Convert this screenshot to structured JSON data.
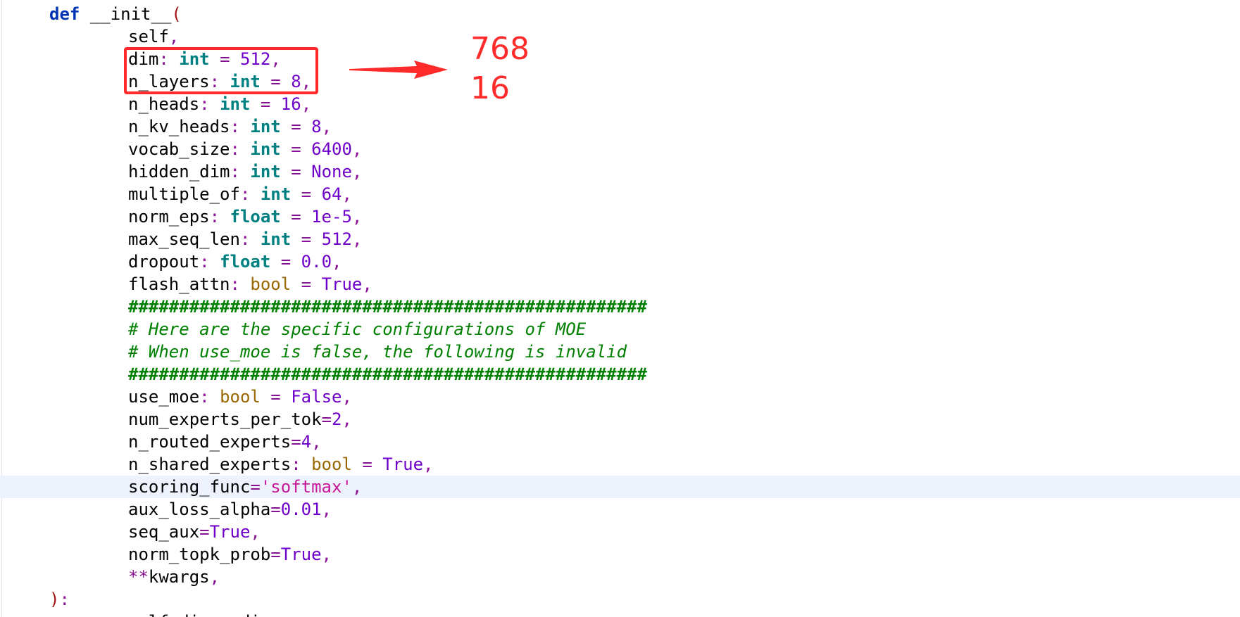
{
  "editor": {
    "lines": [
      {
        "indent": 0,
        "tokens": [
          {
            "t": "def",
            "c": "kw"
          },
          {
            "t": " __init__",
            "c": "fn"
          },
          {
            "t": "(",
            "c": "paren"
          }
        ]
      },
      {
        "indent": 1,
        "tokens": [
          {
            "t": "self",
            "c": "param"
          },
          {
            "t": ",",
            "c": "punct"
          }
        ]
      },
      {
        "indent": 1,
        "tokens": [
          {
            "t": "dim",
            "c": "param"
          },
          {
            "t": ": ",
            "c": "punct"
          },
          {
            "t": "int",
            "c": "type"
          },
          {
            "t": " = ",
            "c": "op"
          },
          {
            "t": "512",
            "c": "num"
          },
          {
            "t": ",",
            "c": "punct"
          }
        ]
      },
      {
        "indent": 1,
        "tokens": [
          {
            "t": "n_layers",
            "c": "param"
          },
          {
            "t": ": ",
            "c": "punct"
          },
          {
            "t": "int",
            "c": "type"
          },
          {
            "t": " = ",
            "c": "op"
          },
          {
            "t": "8",
            "c": "num"
          },
          {
            "t": ",",
            "c": "punct"
          }
        ]
      },
      {
        "indent": 1,
        "tokens": [
          {
            "t": "n_heads",
            "c": "param"
          },
          {
            "t": ": ",
            "c": "punct"
          },
          {
            "t": "int",
            "c": "type"
          },
          {
            "t": " = ",
            "c": "op"
          },
          {
            "t": "16",
            "c": "num"
          },
          {
            "t": ",",
            "c": "punct"
          }
        ]
      },
      {
        "indent": 1,
        "tokens": [
          {
            "t": "n_kv_heads",
            "c": "param"
          },
          {
            "t": ": ",
            "c": "punct"
          },
          {
            "t": "int",
            "c": "type"
          },
          {
            "t": " = ",
            "c": "op"
          },
          {
            "t": "8",
            "c": "num"
          },
          {
            "t": ",",
            "c": "punct"
          }
        ]
      },
      {
        "indent": 1,
        "tokens": [
          {
            "t": "vocab_size",
            "c": "param"
          },
          {
            "t": ": ",
            "c": "punct"
          },
          {
            "t": "int",
            "c": "type"
          },
          {
            "t": " = ",
            "c": "op"
          },
          {
            "t": "6400",
            "c": "num"
          },
          {
            "t": ",",
            "c": "punct"
          }
        ]
      },
      {
        "indent": 1,
        "tokens": [
          {
            "t": "hidden_dim",
            "c": "param"
          },
          {
            "t": ": ",
            "c": "punct"
          },
          {
            "t": "int",
            "c": "type"
          },
          {
            "t": " = ",
            "c": "op"
          },
          {
            "t": "None",
            "c": "const"
          },
          {
            "t": ",",
            "c": "punct"
          }
        ]
      },
      {
        "indent": 1,
        "tokens": [
          {
            "t": "multiple_of",
            "c": "param"
          },
          {
            "t": ": ",
            "c": "punct"
          },
          {
            "t": "int",
            "c": "type"
          },
          {
            "t": " = ",
            "c": "op"
          },
          {
            "t": "64",
            "c": "num"
          },
          {
            "t": ",",
            "c": "punct"
          }
        ]
      },
      {
        "indent": 1,
        "tokens": [
          {
            "t": "norm_eps",
            "c": "param"
          },
          {
            "t": ": ",
            "c": "punct"
          },
          {
            "t": "float",
            "c": "type"
          },
          {
            "t": " = ",
            "c": "op"
          },
          {
            "t": "1e-5",
            "c": "num"
          },
          {
            "t": ",",
            "c": "punct"
          }
        ]
      },
      {
        "indent": 1,
        "tokens": [
          {
            "t": "max_seq_len",
            "c": "param"
          },
          {
            "t": ": ",
            "c": "punct"
          },
          {
            "t": "int",
            "c": "type"
          },
          {
            "t": " = ",
            "c": "op"
          },
          {
            "t": "512",
            "c": "num"
          },
          {
            "t": ",",
            "c": "punct"
          }
        ]
      },
      {
        "indent": 1,
        "tokens": [
          {
            "t": "dropout",
            "c": "param"
          },
          {
            "t": ": ",
            "c": "punct"
          },
          {
            "t": "float",
            "c": "type"
          },
          {
            "t": " = ",
            "c": "op"
          },
          {
            "t": "0.0",
            "c": "num"
          },
          {
            "t": ",",
            "c": "punct"
          }
        ]
      },
      {
        "indent": 1,
        "tokens": [
          {
            "t": "flash_attn",
            "c": "param"
          },
          {
            "t": ": ",
            "c": "punct"
          },
          {
            "t": "bool",
            "c": "builtin"
          },
          {
            "t": " = ",
            "c": "op"
          },
          {
            "t": "True",
            "c": "const"
          },
          {
            "t": ",",
            "c": "punct"
          }
        ]
      },
      {
        "indent": 1,
        "tokens": [
          {
            "t": "###################################################",
            "c": "hash"
          }
        ]
      },
      {
        "indent": 1,
        "tokens": [
          {
            "t": "# Here are the specific configurations of MOE",
            "c": "comment"
          }
        ]
      },
      {
        "indent": 1,
        "tokens": [
          {
            "t": "# When use_moe is false, the following is invalid",
            "c": "comment"
          }
        ]
      },
      {
        "indent": 1,
        "tokens": [
          {
            "t": "###################################################",
            "c": "hash"
          }
        ]
      },
      {
        "indent": 1,
        "tokens": [
          {
            "t": "use_moe",
            "c": "param"
          },
          {
            "t": ": ",
            "c": "punct"
          },
          {
            "t": "bool",
            "c": "builtin"
          },
          {
            "t": " = ",
            "c": "op"
          },
          {
            "t": "False",
            "c": "const"
          },
          {
            "t": ",",
            "c": "punct"
          }
        ]
      },
      {
        "indent": 1,
        "tokens": [
          {
            "t": "num_experts_per_tok",
            "c": "param"
          },
          {
            "t": "=",
            "c": "op"
          },
          {
            "t": "2",
            "c": "num"
          },
          {
            "t": ",",
            "c": "punct"
          }
        ]
      },
      {
        "indent": 1,
        "tokens": [
          {
            "t": "n_routed_experts",
            "c": "param"
          },
          {
            "t": "=",
            "c": "op"
          },
          {
            "t": "4",
            "c": "num"
          },
          {
            "t": ",",
            "c": "punct"
          }
        ]
      },
      {
        "indent": 1,
        "tokens": [
          {
            "t": "n_shared_experts",
            "c": "param"
          },
          {
            "t": ": ",
            "c": "punct"
          },
          {
            "t": "bool",
            "c": "builtin"
          },
          {
            "t": " = ",
            "c": "op"
          },
          {
            "t": "True",
            "c": "const"
          },
          {
            "t": ",",
            "c": "punct"
          }
        ]
      },
      {
        "indent": 1,
        "current": true,
        "tokens": [
          {
            "t": "scoring_func",
            "c": "param"
          },
          {
            "t": "=",
            "c": "op"
          },
          {
            "t": "'softmax'",
            "c": "str"
          },
          {
            "t": ",",
            "c": "punct"
          }
        ]
      },
      {
        "indent": 1,
        "tokens": [
          {
            "t": "aux_loss_alpha",
            "c": "param"
          },
          {
            "t": "=",
            "c": "op"
          },
          {
            "t": "0.01",
            "c": "num"
          },
          {
            "t": ",",
            "c": "punct"
          }
        ]
      },
      {
        "indent": 1,
        "tokens": [
          {
            "t": "seq_aux",
            "c": "param"
          },
          {
            "t": "=",
            "c": "op"
          },
          {
            "t": "True",
            "c": "const"
          },
          {
            "t": ",",
            "c": "punct"
          }
        ]
      },
      {
        "indent": 1,
        "tokens": [
          {
            "t": "norm_topk_prob",
            "c": "param"
          },
          {
            "t": "=",
            "c": "op"
          },
          {
            "t": "True",
            "c": "const"
          },
          {
            "t": ",",
            "c": "punct"
          }
        ]
      },
      {
        "indent": 1,
        "tokens": [
          {
            "t": "**",
            "c": "op"
          },
          {
            "t": "kwargs",
            "c": "param"
          },
          {
            "t": ",",
            "c": "punct"
          }
        ]
      },
      {
        "indent": 0,
        "tokens": [
          {
            "t": ")",
            "c": "paren"
          },
          {
            "t": ":",
            "c": "punct"
          }
        ]
      },
      {
        "indent": 1,
        "tokens": [
          {
            "t": "self.dim = dim",
            "c": "param"
          }
        ]
      }
    ]
  },
  "annotation": {
    "values": [
      "768",
      "16"
    ],
    "color": "#ff2a2a"
  },
  "theme": {
    "background": "#ffffff",
    "current_line": "#edf2fc"
  }
}
